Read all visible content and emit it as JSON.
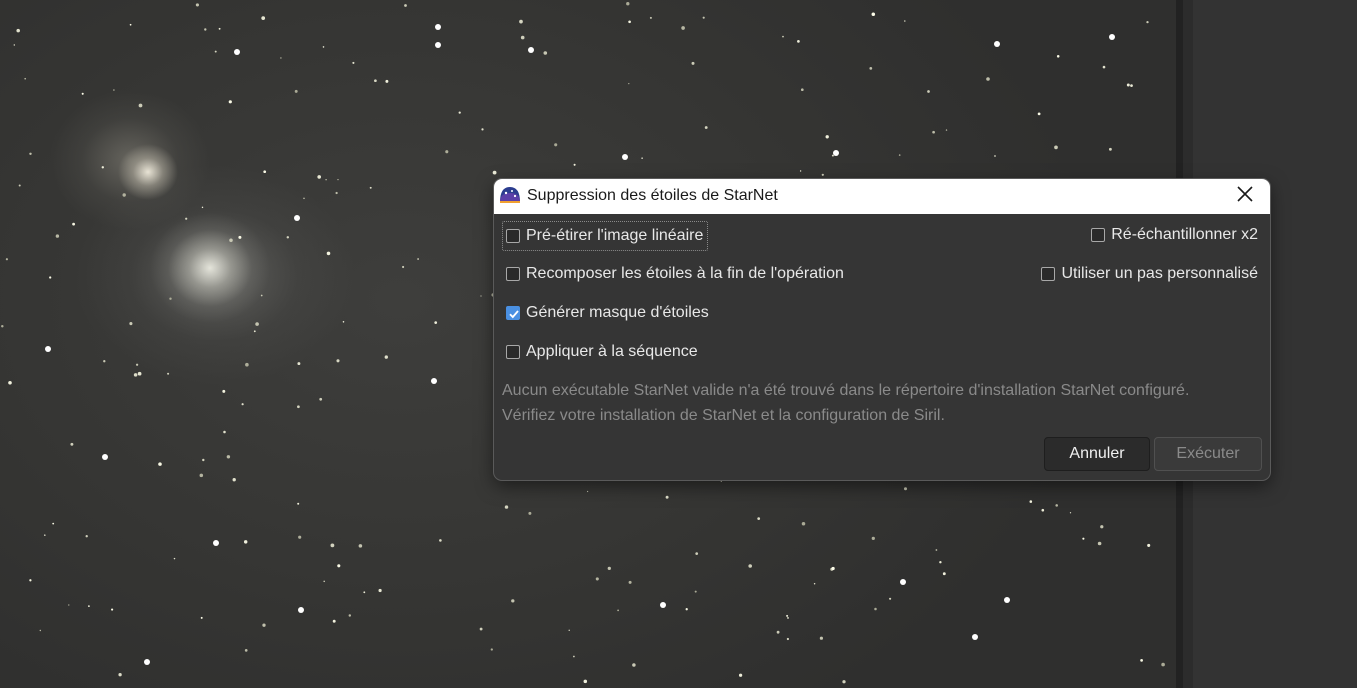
{
  "dialog": {
    "title": "Suppression des étoiles de StarNet",
    "app_icon": "siril-icon",
    "close_icon": "close-icon",
    "options": {
      "prestretch": {
        "label": "Pré-étirer l'image linéaire",
        "checked": false
      },
      "recompose": {
        "label": "Recomposer les étoiles à la fin de l'opération",
        "checked": false
      },
      "generate_mask": {
        "label": "Générer masque d'étoiles",
        "checked": true
      },
      "apply_sequence": {
        "label": "Appliquer à la séquence",
        "checked": false
      },
      "upsample": {
        "label": "Ré-échantillonner x2",
        "checked": false
      },
      "custom_stride": {
        "label": "Utiliser un pas personnalisé",
        "checked": false
      }
    },
    "message_line1": "Aucun exécutable StarNet valide n'a été trouvé dans le répertoire d'installation StarNet configuré.",
    "message_line2": "Vérifiez votre installation de StarNet et la configuration de Siril.",
    "buttons": {
      "cancel": "Annuler",
      "execute": "Exécuter"
    }
  },
  "colors": {
    "accent": "#4a90e2",
    "dialog_bg": "#353535",
    "titlebar_bg": "#ffffff"
  }
}
